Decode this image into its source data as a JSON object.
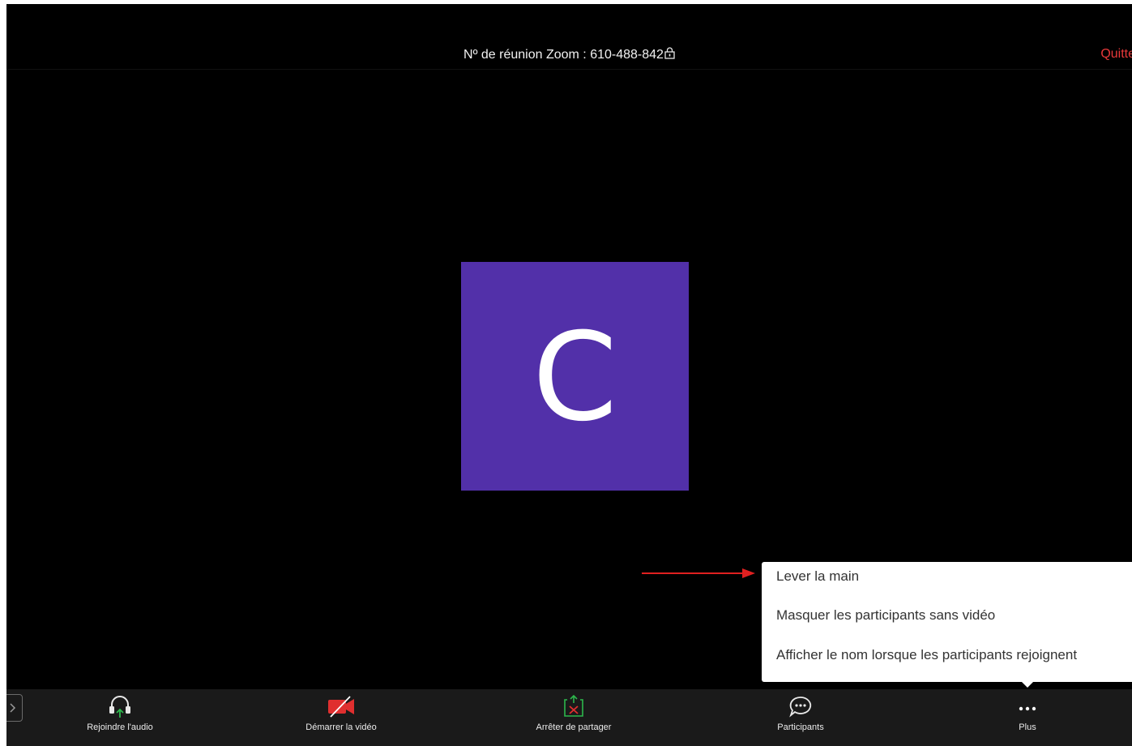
{
  "header": {
    "meeting_id": "Nº de réunion Zoom : 610-488-842",
    "quit_label": "Quitte"
  },
  "participant": {
    "initial": "C",
    "avatar_color": "#5230a9"
  },
  "more_menu": {
    "items": [
      {
        "label": "Lever la main"
      },
      {
        "label": "Masquer les participants sans vidéo"
      },
      {
        "label": "Afficher le nom lorsque les participants rejoignent"
      }
    ]
  },
  "annotation": {
    "arrow_color": "#e02020"
  },
  "toolbar": {
    "items": [
      {
        "label": "Rejoindre l'audio",
        "icon": "headphones-icon"
      },
      {
        "label": "Démarrer la vidéo",
        "icon": "video-off-icon"
      },
      {
        "label": "Arrêter de partager",
        "icon": "stop-share-icon"
      },
      {
        "label": "Participants",
        "icon": "chat-bubble-icon"
      },
      {
        "label": "Plus",
        "icon": "more-icon"
      }
    ]
  },
  "colors": {
    "background": "#000000",
    "quit": "#e8393a",
    "accent_green": "#2db84c",
    "video_off_red": "#e02f2f"
  }
}
